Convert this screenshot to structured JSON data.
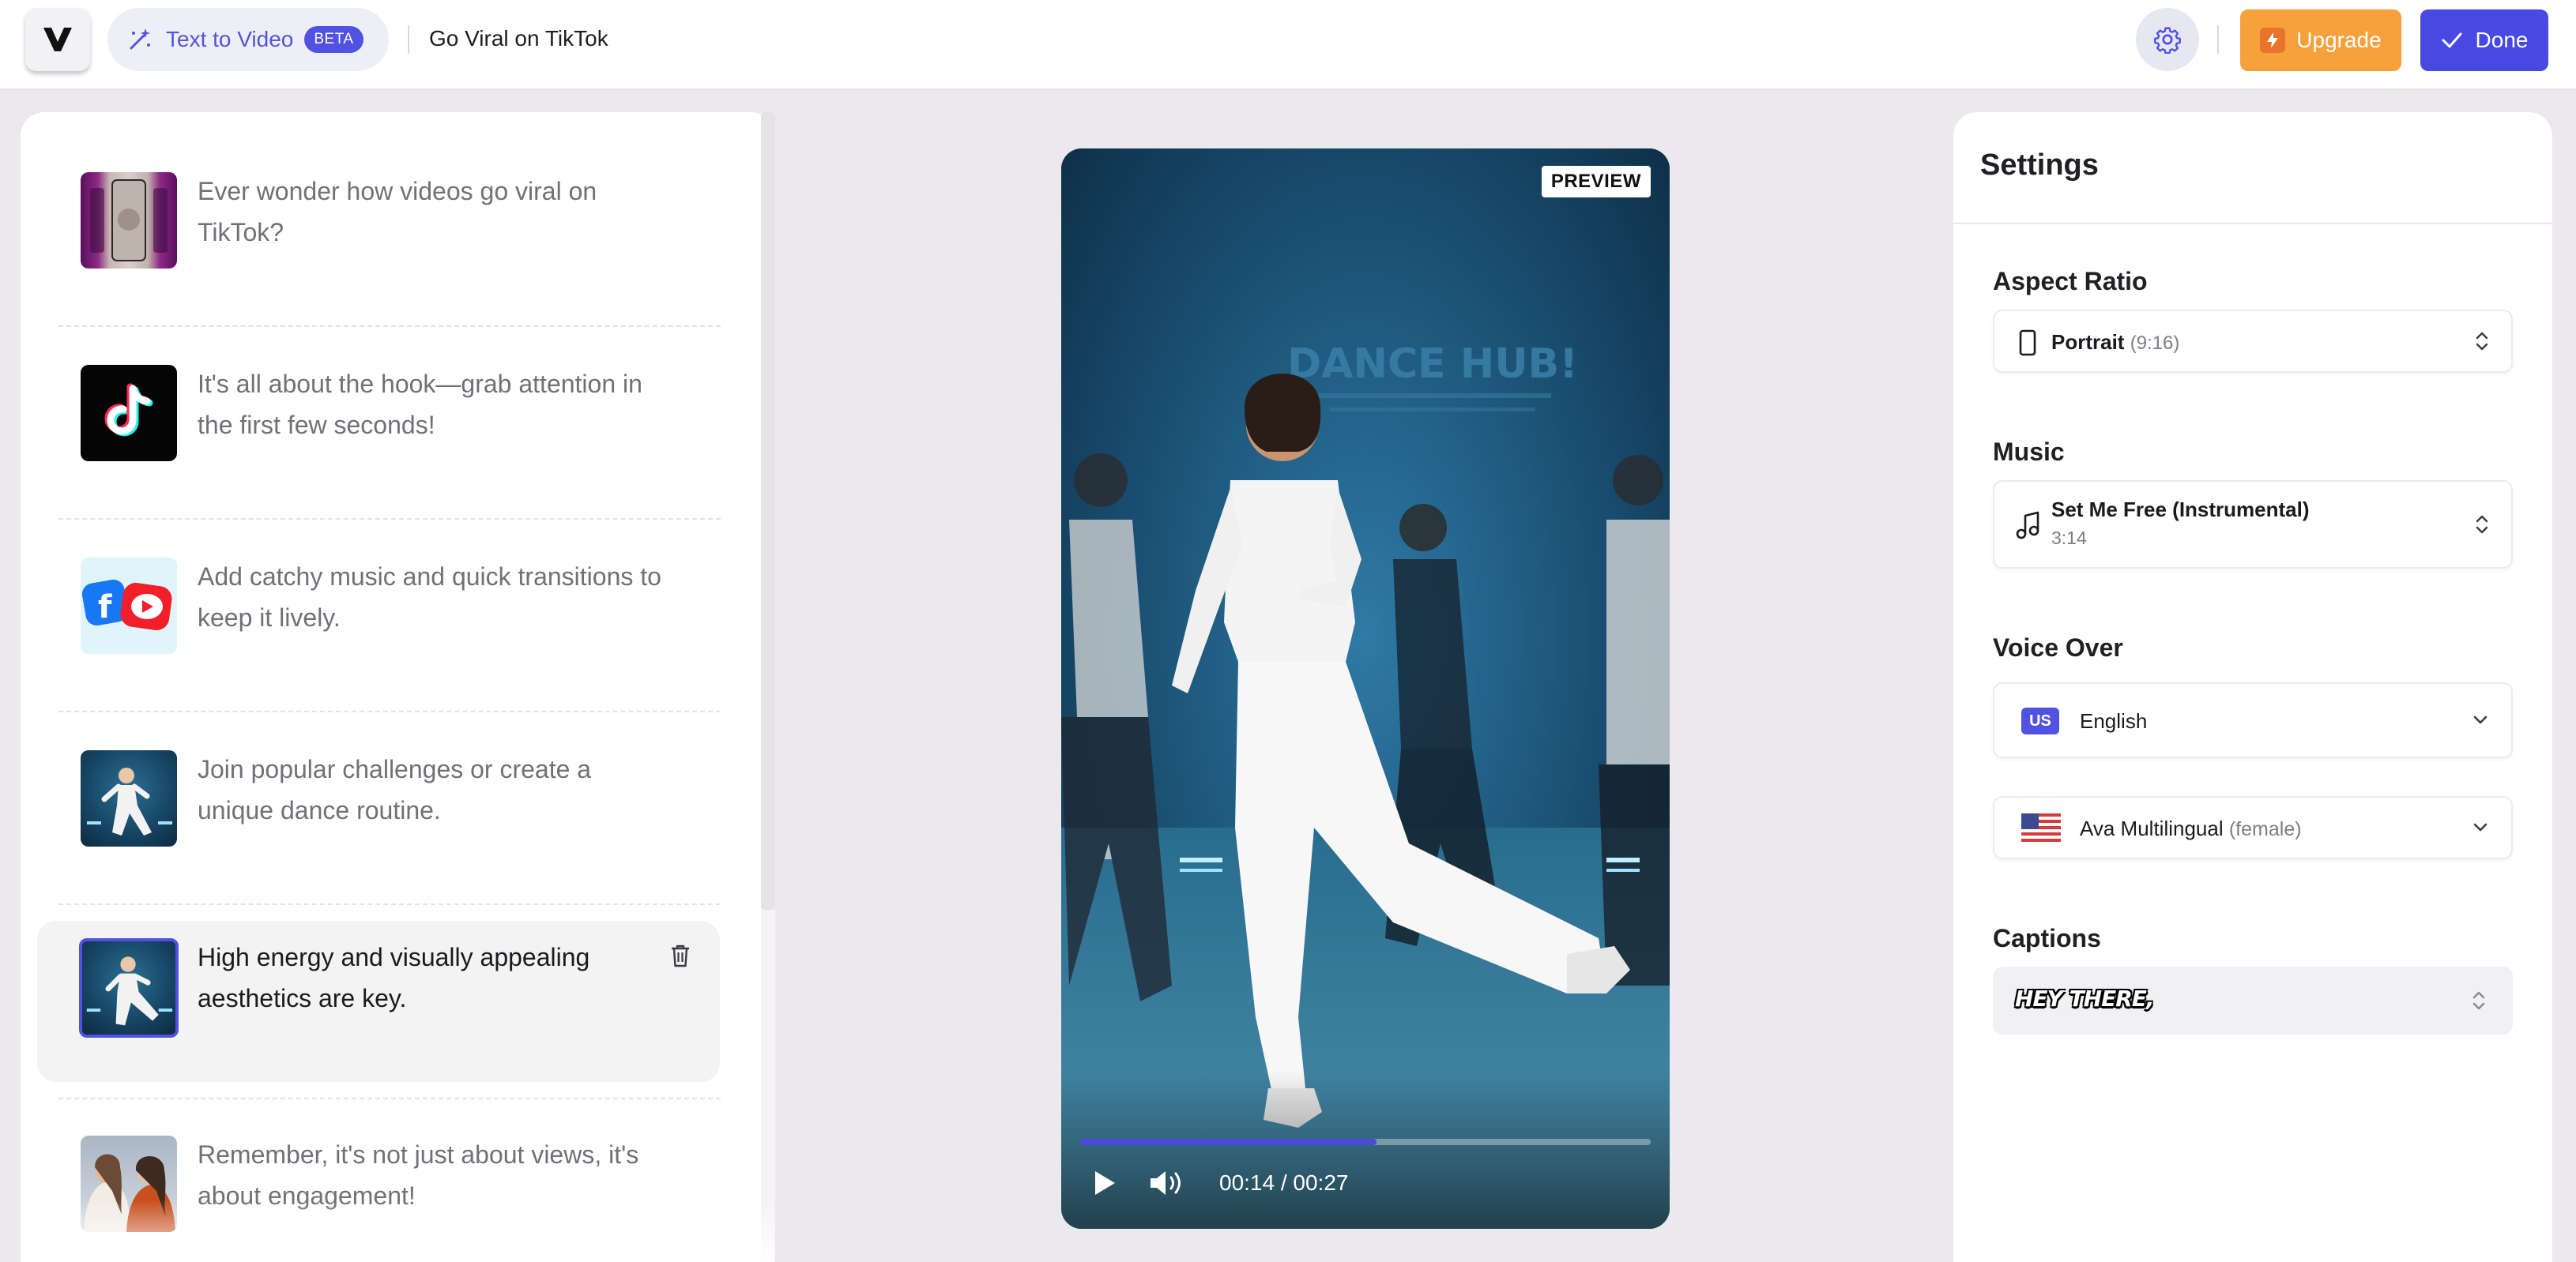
{
  "topbar": {
    "logo_text": "V",
    "mode_label": "Text to Video",
    "beta_badge": "BETA",
    "project_title": "Go Viral on TikTok",
    "upgrade_label": "Upgrade",
    "done_label": "Done"
  },
  "scenes": [
    {
      "text": "Ever wonder how videos go viral on TikTok?",
      "thumb": "phone-grid-thumbnail"
    },
    {
      "text": "It's all about the hook—grab attention in the first few seconds!",
      "thumb": "tiktok-logo-thumbnail"
    },
    {
      "text": "Add catchy music and quick transitions to keep it lively.",
      "thumb": "social-icons-thumbnail"
    },
    {
      "text": "Join popular challenges or create a unique dance routine.",
      "thumb": "dance-thumbnail"
    },
    {
      "text": "High energy and visually appealing aesthetics are key.",
      "thumb": "dance-thumbnail",
      "active": true
    },
    {
      "text": "Remember, it's not just about views, it's about engagement!",
      "thumb": "friends-selfie-thumbnail"
    }
  ],
  "preview": {
    "badge": "PREVIEW",
    "wall_text": "DANCE HUB!",
    "current_time": "00:14",
    "duration": "00:27",
    "time_display": "00:14 / 00:27",
    "progress_fraction": 0.52
  },
  "settings": {
    "title": "Settings",
    "aspect_ratio": {
      "label": "Aspect Ratio",
      "value": "Portrait",
      "detail": "(9:16)"
    },
    "music": {
      "label": "Music",
      "track": "Set Me Free (Instrumental)",
      "length": "3:14"
    },
    "voice_over": {
      "label": "Voice Over",
      "language_code": "US",
      "language": "English",
      "voice": "Ava Multilingual",
      "voice_detail": "(female)"
    },
    "captions": {
      "label": "Captions",
      "style_preview": "HEY THERE,"
    }
  },
  "colors": {
    "accent": "#5151e2",
    "upgrade": "#f6a13c",
    "done": "#4848e2"
  }
}
